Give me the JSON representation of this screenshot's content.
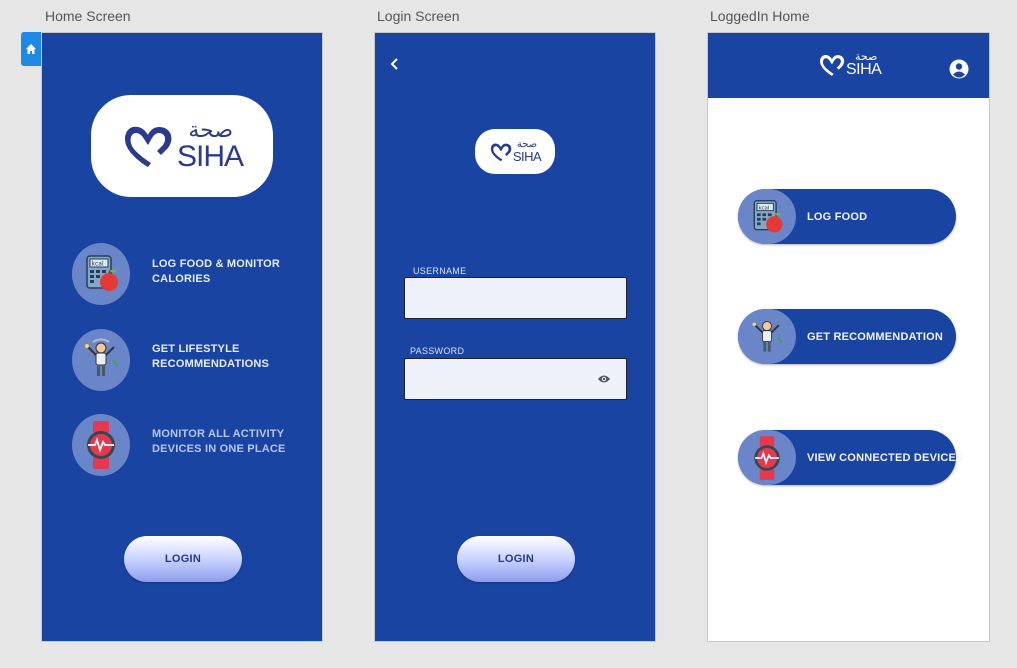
{
  "artboards": {
    "home": {
      "label": "Home Screen"
    },
    "login": {
      "label": "Login Screen"
    },
    "logged_in": {
      "label": "LoggedIn Home"
    }
  },
  "brand": {
    "latin": "SIHA",
    "arabic": "صحة"
  },
  "home_screen": {
    "features": [
      {
        "line1": "LOG FOOD  & MONITOR",
        "line2": "CALORIES",
        "icon": "calorie-calculator-icon"
      },
      {
        "line1": "GET LIFESTYLE",
        "line2": "RECOMMENDATIONS",
        "icon": "person-exercise-icon"
      },
      {
        "line1": "MONITOR ALL ACTIVITY",
        "line2": "DEVICES IN ONE PLACE",
        "icon": "heart-rate-watch-icon"
      }
    ],
    "login_label": "LOGIN"
  },
  "login_screen": {
    "username_label": "USERNAME",
    "username_value": "",
    "password_label": "PASSWORD",
    "password_value": "",
    "login_label": "LOGIN"
  },
  "logged_in_home": {
    "buttons": [
      {
        "label": "LOG FOOD",
        "icon": "calorie-calculator-icon"
      },
      {
        "label": "GET RECOMMENDATION",
        "icon": "person-exercise-icon"
      },
      {
        "label": "VIEW CONNECTED DEVICES",
        "icon": "heart-rate-watch-icon"
      }
    ]
  },
  "colors": {
    "primary_blue": "#1a44a2",
    "icon_circle": "#6a86c8",
    "logo_navy": "#2a3a8c",
    "canvas_gray": "#e6e6e6"
  }
}
